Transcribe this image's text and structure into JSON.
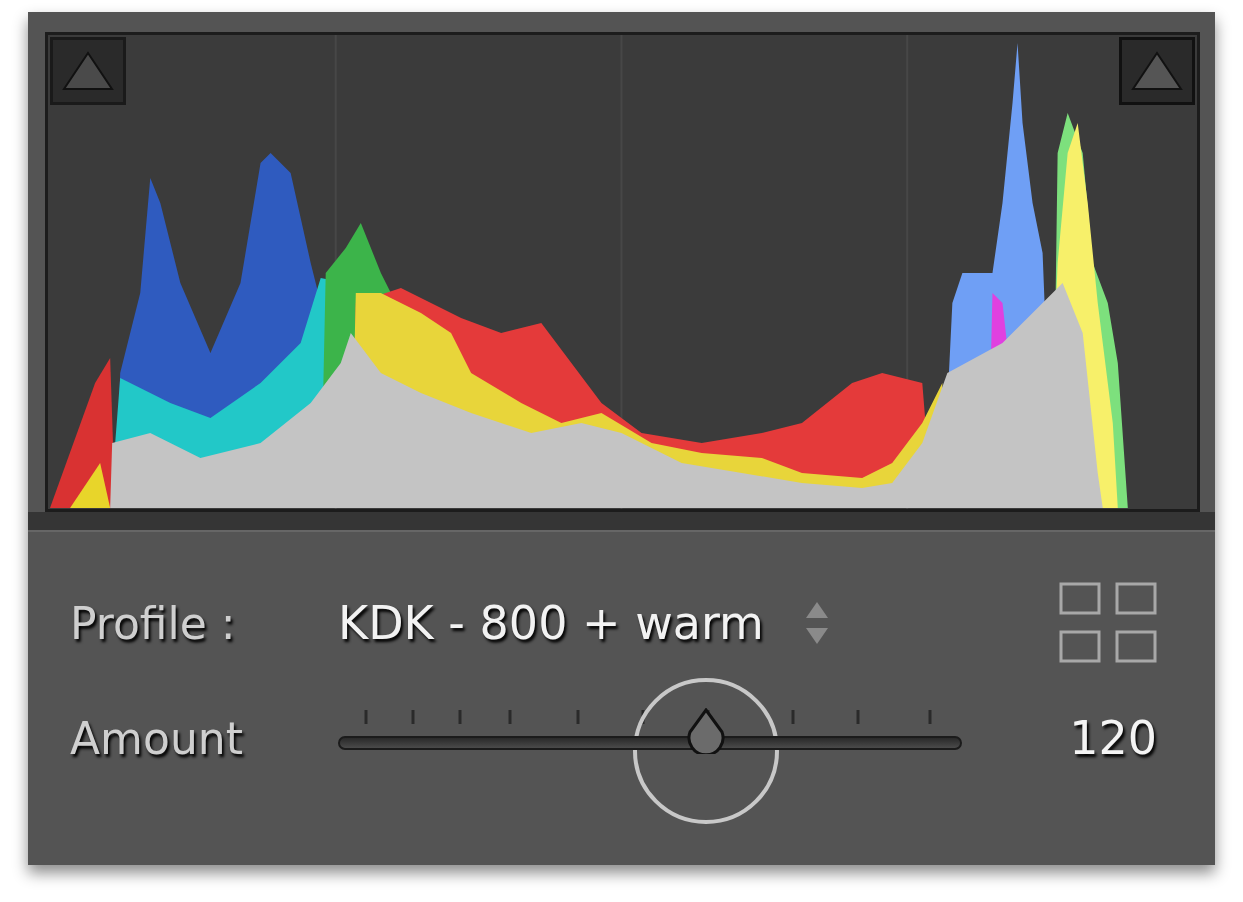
{
  "profile": {
    "label": "Profile :",
    "value": "KDK - 800 + warm"
  },
  "amount": {
    "label": "Amount",
    "level": 0.59,
    "reading": "120"
  }
}
